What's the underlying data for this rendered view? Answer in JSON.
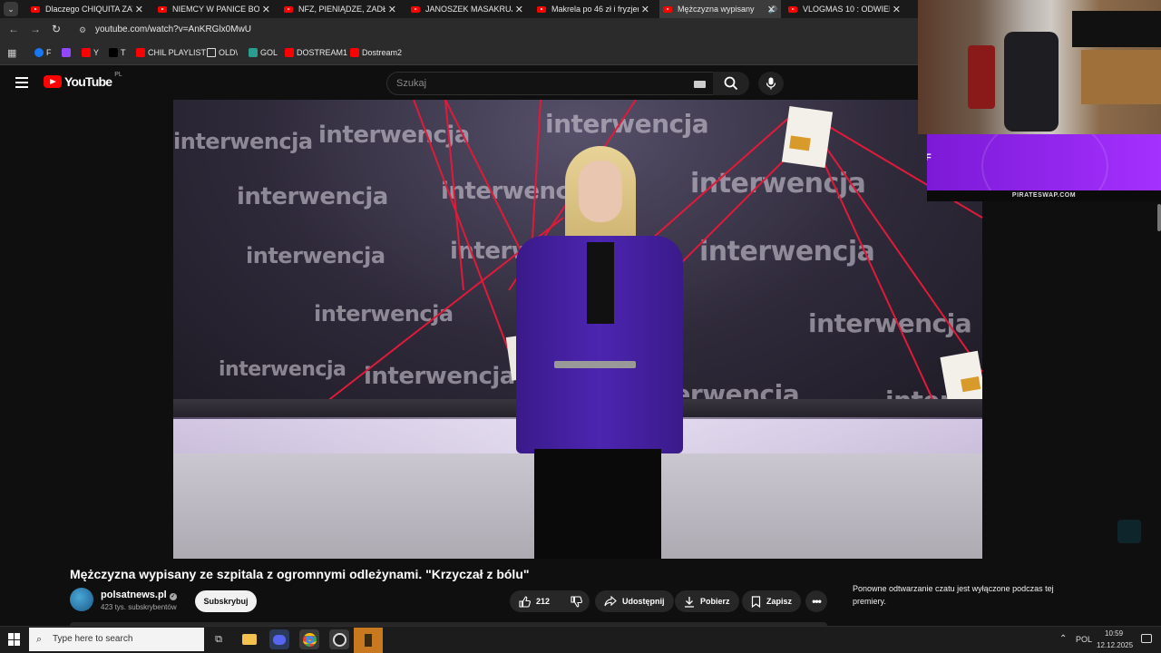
{
  "browser": {
    "tabs": [
      {
        "title": "Dlaczego CHIQUITA ZATR",
        "active": false
      },
      {
        "title": "NIEMCY W PANICE BO US",
        "active": false
      },
      {
        "title": "NFZ, PIENIĄDZE, ZADŁUŻ",
        "active": false
      },
      {
        "title": "JANOSZEK MASAKRUJE S",
        "active": false
      },
      {
        "title": "Makrela po 46 zł i fryzjer",
        "active": false
      },
      {
        "title": "Mężczyzna wypisany",
        "active": true
      },
      {
        "title": "VLOGMAS 10 : ODWIEDZ",
        "active": false
      }
    ],
    "url": "youtube.com/watch?v=AnKRGlx0MwU",
    "bookmarks": [
      {
        "label": "F",
        "icon": "facebook-icon"
      },
      {
        "label": "",
        "icon": "twitch-icon"
      },
      {
        "label": "Y",
        "icon": "youtube-icon"
      },
      {
        "label": "T",
        "icon": "x-icon"
      },
      {
        "label": "CHIL PLAYLIST",
        "icon": "youtube-icon"
      },
      {
        "label": "OLD\\",
        "icon": "folder-icon"
      },
      {
        "label": "GOL",
        "icon": "g-icon"
      },
      {
        "label": "DOSTREAM1",
        "icon": "youtube-icon"
      },
      {
        "label": "Dostream2",
        "icon": "youtube-icon"
      }
    ]
  },
  "youtube": {
    "logo_text": "YouTube",
    "logo_region": "PL",
    "search_placeholder": "Szukaj",
    "video_watermark": "interwencja",
    "video": {
      "title": "Mężczyzna wypisany ze szpitala z ogromnymi odleżynami. \"Krzyczał z bólu\"",
      "channel": "polsatnews.pl",
      "subscribers": "423 tys. subskrybentów",
      "subscribe_label": "Subskrybuj",
      "likes": "212",
      "share_label": "Udostępnij",
      "download_label": "Pobierz",
      "save_label": "Zapisz"
    },
    "chat_message": "Ponowne odtwarzanie czatu jest wyłączone podczas tej premiery."
  },
  "overlay": {
    "sponsor_text": "PIRATESWAP.COM",
    "purple_letter": "F"
  },
  "taskbar": {
    "search_placeholder": "Type here to search",
    "language": "POL",
    "time": "10:59",
    "date": "12.12.2025"
  },
  "colors": {
    "yt_red": "#ff0000",
    "background": "#0f0f0f",
    "overlay_purple": "#8f22ee"
  }
}
